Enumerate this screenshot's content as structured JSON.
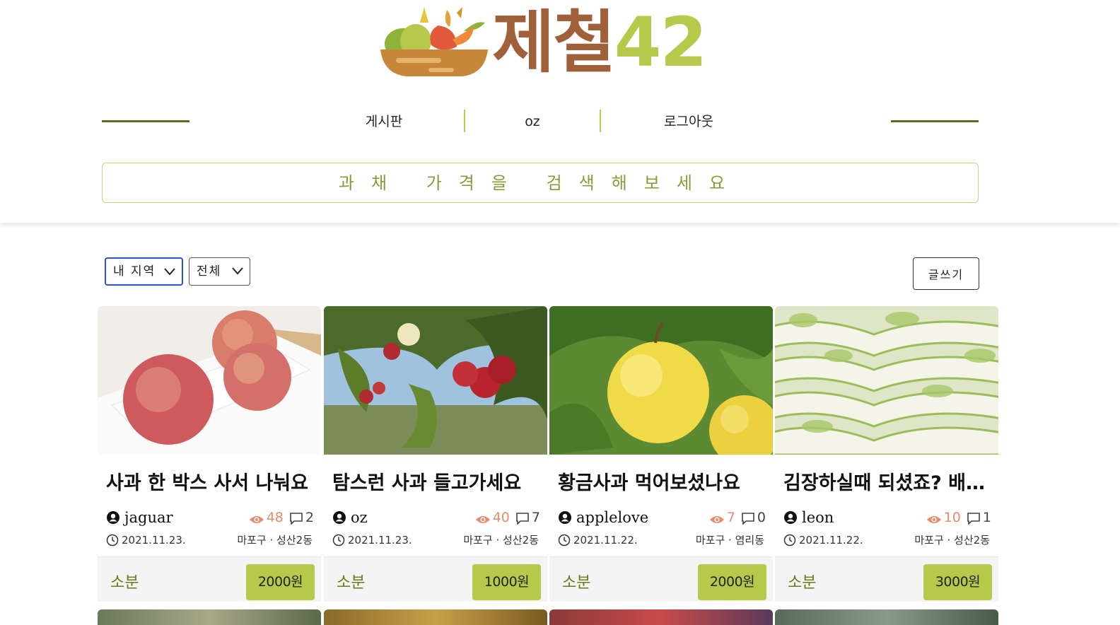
{
  "logo": {
    "text_ko": "제철",
    "text_num": "42"
  },
  "nav": {
    "items": [
      {
        "label": "게시판"
      },
      {
        "label": "oz"
      },
      {
        "label": "로그아웃"
      }
    ]
  },
  "search": {
    "placeholder": "과채 가격을 검색해보세요"
  },
  "filters": {
    "region": "내 지역",
    "category": "전체"
  },
  "write_button": "글쓰기",
  "cards": [
    {
      "title": "사과 한 박스 사서 나눠요",
      "author": "jaguar",
      "views": "48",
      "comments": "2",
      "date": "2021.11.23.",
      "location": "마포구 · 성산2동",
      "type": "소분",
      "price": "2000원"
    },
    {
      "title": "탐스런 사과 들고가세요",
      "author": "oz",
      "views": "40",
      "comments": "7",
      "date": "2021.11.23.",
      "location": "마포구 · 성산2동",
      "type": "소분",
      "price": "1000원"
    },
    {
      "title": "황금사과 먹어보셨나요",
      "author": "applelove",
      "views": "7",
      "comments": "0",
      "date": "2021.11.22.",
      "location": "마포구 · 염리동",
      "type": "소분",
      "price": "2000원"
    },
    {
      "title": "김장하실때 되셨죠? 배추 나눠요",
      "author": "leon",
      "views": "10",
      "comments": "1",
      "date": "2021.11.22.",
      "location": "마포구 · 성산2동",
      "type": "소분",
      "price": "3000원"
    }
  ],
  "colors": {
    "accent": "#b7c94b",
    "brand_brown": "#a0603a",
    "views": "#e58b6e",
    "nav_line": "#5a6a22"
  }
}
